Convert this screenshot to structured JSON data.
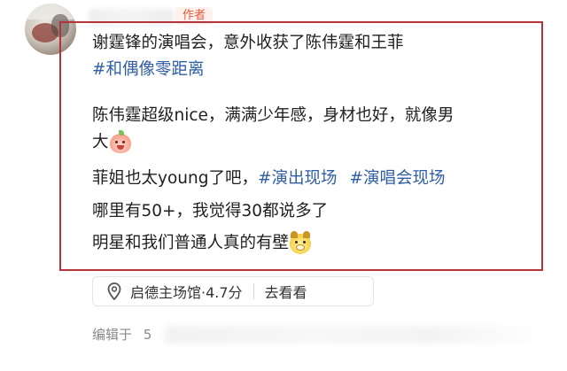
{
  "author_badge": "作者",
  "post": {
    "line1": "谢霆锋的演唱会，意外收获了陈伟霆和王菲",
    "line2_tag": "#和偶像零距离",
    "line3": "陈伟霆超级nice，满满少年感，身材也好，就像男",
    "line4": "大",
    "line5_text": "菲姐也太young了吧，",
    "line5_tag1": "#演出现场",
    "line5_tag2": "#演唱会现场",
    "line6": "哪里有50+，我觉得30都说多了",
    "line7": "明星和我们普通人真的有壁"
  },
  "icons": {
    "avatar": "user-avatar",
    "emoji_1": "peach-face-emoji",
    "emoji_2": "dog-face-emoji",
    "location": "location-pin-icon"
  },
  "location": {
    "text": "启德主场馆·4.7分",
    "action": "去看看"
  },
  "edited": {
    "label": "编辑于",
    "date_prefix": "5"
  },
  "colors": {
    "highlight_border": "#b3343a",
    "tag": "#2e5ea3",
    "badge_text": "#e85a3c"
  }
}
